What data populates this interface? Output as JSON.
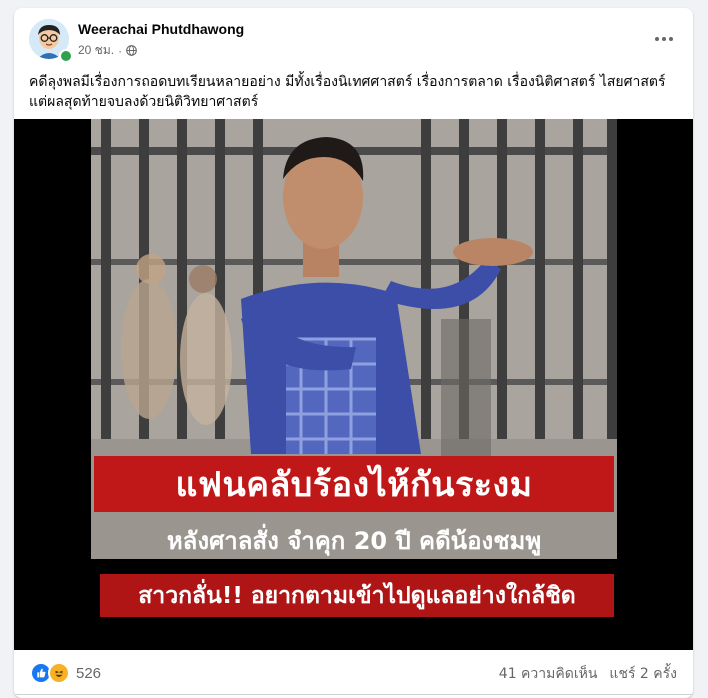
{
  "post": {
    "author": "Weerachai Phutdhawong",
    "time": "20 ชม.",
    "separator": "·",
    "privacy_icon": "globe-icon",
    "text": "คดีลุงพลมีเรื่องการถอดบทเรียนหลายอย่าง มีทั้งเรื่องนิเทศศาสตร์ เรื่องการตลาด เรื่องนิติศาสตร์ ไสยศาสตร์ แต่ผลสุดท้ายจบลงด้วยนิติวิทยาศาสตร์"
  },
  "media": {
    "headline": "แฟนคลับร้องไห้กันระงม",
    "subline1": "หลังศาลสั่ง จำคุก 20 ปี คดีน้องชมพู",
    "subline2": "สาวกลั่น!! อยากตามเข้าไปดูแลอย่างใกล้ชิด"
  },
  "footer": {
    "reaction_count": "526",
    "comments": "41 ความคิดเห็น",
    "shares": "แชร์ 2 ครั้ง",
    "reaction_icons": [
      "like-icon",
      "haha-icon"
    ]
  },
  "colors": {
    "banner_red": "#c01818",
    "fb_blue": "#1877f2",
    "online_green": "#31a24c"
  }
}
